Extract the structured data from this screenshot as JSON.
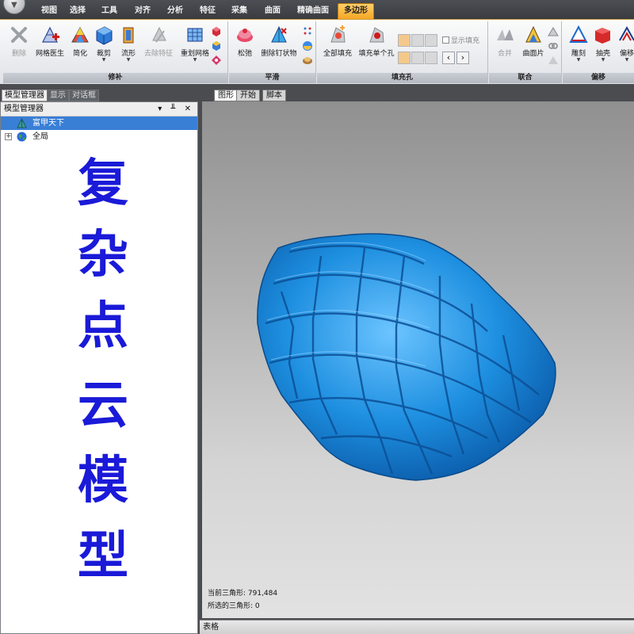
{
  "menu": {
    "app_glyph": "▼",
    "tabs": [
      {
        "label": "视图"
      },
      {
        "label": "选择"
      },
      {
        "label": "工具"
      },
      {
        "label": "对齐"
      },
      {
        "label": "分析"
      },
      {
        "label": "特征"
      },
      {
        "label": "采集"
      },
      {
        "label": "曲面"
      },
      {
        "label": "精确曲面"
      },
      {
        "label": "多边形",
        "active": true
      }
    ]
  },
  "ribbon": {
    "groups": [
      {
        "title": "修补",
        "buttons": [
          {
            "label": "删除",
            "icon": "delete-icon",
            "disabled": true
          },
          {
            "label": "网格医生",
            "icon": "mesh-doctor-icon"
          },
          {
            "label": "简化",
            "icon": "decimate-icon"
          },
          {
            "label": "裁剪",
            "icon": "trim-icon"
          },
          {
            "label": "流形",
            "icon": "manifold-icon"
          },
          {
            "label": "去除特征",
            "icon": "remove-feature-icon",
            "disabled": true
          },
          {
            "label": "重划网格",
            "icon": "remesh-icon"
          }
        ]
      },
      {
        "title": "平滑",
        "buttons": [
          {
            "label": "松弛",
            "icon": "relax-icon"
          },
          {
            "label": "删除钉状物",
            "icon": "remove-spikes-icon"
          }
        ]
      },
      {
        "title": "填充孔",
        "buttons": [
          {
            "label": "全部填充",
            "icon": "fill-all-icon"
          },
          {
            "label": "填充单个孔",
            "icon": "fill-single-icon"
          }
        ],
        "checkbox_label": "显示填充"
      },
      {
        "title": "联合",
        "buttons": [
          {
            "label": "合并",
            "icon": "merge-icon",
            "disabled": true
          },
          {
            "label": "曲面片",
            "icon": "patch-icon"
          }
        ]
      },
      {
        "title": "偏移",
        "buttons": [
          {
            "label": "雕刻",
            "icon": "sculpt-icon"
          },
          {
            "label": "抽壳",
            "icon": "shell-icon"
          },
          {
            "label": "偏移",
            "icon": "offset-icon"
          }
        ]
      }
    ]
  },
  "left_panel": {
    "tabs": [
      "模型管理器",
      "显示",
      "对话框"
    ],
    "header": "模型管理器",
    "header_controls": "▾ ╨ ✕",
    "tree": [
      {
        "label": "富甲天下",
        "selected": true,
        "icon": "mesh-icon"
      },
      {
        "label": "全局",
        "selected": false,
        "icon": "globe-icon",
        "expander": "+"
      }
    ],
    "overlay_text": [
      "复",
      "杂",
      "点",
      "云",
      "模",
      "型"
    ]
  },
  "viewport": {
    "tabs": [
      "图形",
      "开始",
      "脚本"
    ],
    "stats": {
      "current_triangles": "当前三角形: 791,484",
      "selected_triangles": "所选的三角形: 0"
    },
    "model_color": "#1e8fe0"
  },
  "bottom_bar": {
    "label": "表格"
  },
  "colors": {
    "active_tab": "#f5a623",
    "selection": "#3a7fd6",
    "overlay_text": "#1a1ad8"
  }
}
